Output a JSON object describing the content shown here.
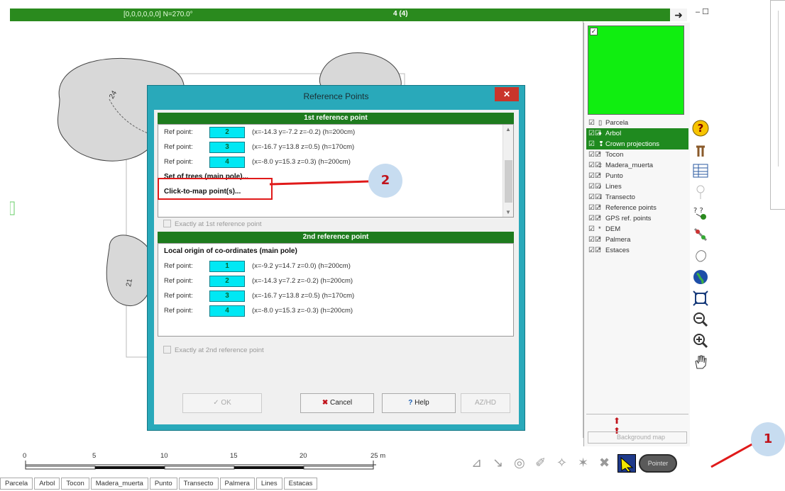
{
  "topbar": {
    "coords": "[0,0,0,0,0,0] N=270.0°",
    "count": "4 (4)",
    "arrow": "➜",
    "minmax": "– ☐"
  },
  "legend": {
    "layers": [
      {
        "check": "☑",
        "icon": "▯",
        "label": "Parcela",
        "selected": false
      },
      {
        "check": "☑☑",
        "icon": "♦",
        "label": "Arbol",
        "selected": true
      },
      {
        "check": "☑",
        "icon": "❢",
        "label": "Crown projections",
        "selected": true
      },
      {
        "check": "☑☑",
        "icon": "*",
        "label": "Tocon",
        "selected": false
      },
      {
        "check": "☑☑",
        "icon": "‡",
        "label": "Madera_muerta",
        "selected": false
      },
      {
        "check": "☑☑",
        "icon": "*",
        "label": "Punto",
        "selected": false
      },
      {
        "check": "☑☑",
        "icon": "♪",
        "label": "Lines",
        "selected": false
      },
      {
        "check": "☑☑",
        "icon": "⇃",
        "label": "Transecto",
        "selected": false
      },
      {
        "check": "☑☑",
        "icon": "*",
        "label": "Reference points",
        "selected": false
      },
      {
        "check": "☑☑",
        "icon": "*",
        "label": "GPS ref. points",
        "selected": false
      },
      {
        "check": "☑",
        "icon": "*",
        "label": "DEM",
        "selected": false
      },
      {
        "check": "☑☑",
        "icon": "*",
        "label": "Palmera",
        "selected": false
      },
      {
        "check": "☑☑",
        "icon": "*",
        "label": "Estaces",
        "selected": false
      }
    ],
    "background_label": "Background map",
    "arrows": "⬆ ⬆"
  },
  "toolbar_icons": [
    "help-icon",
    "tree-icon",
    "table-icon",
    "pin-icon",
    "nodes-icon",
    "satellite-icon",
    "crown-icon",
    "globe-icon",
    "fit-extent-icon",
    "zoom-out-icon",
    "zoom-in-icon",
    "pan-hand-icon"
  ],
  "dialog": {
    "title": "Reference Points",
    "close": "✕",
    "first": {
      "header": "1st reference point",
      "rows": [
        {
          "label": "Ref point:",
          "num": "2",
          "info": "(x=-14.3 y=-7.2 z=-0.2) (h=200cm)"
        },
        {
          "label": "Ref point:",
          "num": "3",
          "info": "(x=-16.7 y=13.8 z=0.5) (h=170cm)"
        },
        {
          "label": "Ref point:",
          "num": "4",
          "info": "(x=-8.0 y=15.3 z=0.3) (h=200cm)"
        }
      ],
      "set_of_trees": "Set of trees (main pole)...",
      "click_to_map": "Click-to-map point(s)...",
      "exactly": "Exactly at 1st reference point"
    },
    "second": {
      "header": "2nd reference point",
      "origin": "Local origin of co-ordinates (main pole)",
      "rows": [
        {
          "label": "Ref point:",
          "num": "1",
          "info": "(x=-9.2 y=14.7 z=0.0) (h=200cm)"
        },
        {
          "label": "Ref point:",
          "num": "2",
          "info": "(x=-14.3 y=7.2 z=-0.2) (h=200cm)"
        },
        {
          "label": "Ref point:",
          "num": "3",
          "info": "(x=-16.7 y=13.8 z=0.5) (h=170cm)"
        },
        {
          "label": "Ref point:",
          "num": "4",
          "info": "(x=-8.0 y=15.3 z=-0.3) (h=200cm)"
        }
      ],
      "exactly": "Exactly at 2nd reference point"
    },
    "buttons": {
      "ok": "✓ OK",
      "cancel": "✖ Cancel",
      "help": "? Help",
      "azhd": "AZ/HD"
    }
  },
  "scale": {
    "ticks": [
      "0",
      "5",
      "10",
      "15",
      "20",
      "25 m"
    ]
  },
  "bottom_tabs": [
    "Parcela",
    "Arbol",
    "Tocon",
    "Madera_muerta",
    "Punto",
    "Transecto",
    "Palmera",
    "Lines",
    "Estacas"
  ],
  "bottom_tool_button": "Pointer",
  "callouts": {
    "one": "1",
    "two": "2"
  },
  "map_labels": {
    "a": "24",
    "b": "21"
  }
}
